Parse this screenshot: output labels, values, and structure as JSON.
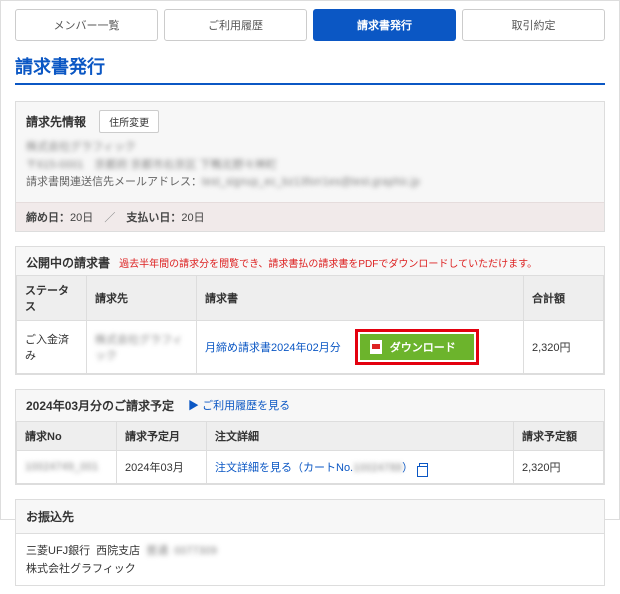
{
  "tabs": {
    "member_list": "メンバー一覧",
    "usage_history": "ご利用履歴",
    "invoice_issue": "請求書発行",
    "transaction_terms": "取引約定"
  },
  "page_title": "請求書発行",
  "billing_info": {
    "title": "請求先情報",
    "change_address_btn": "住所変更",
    "company_blur": "株式会社グラフィック",
    "postal_blur": "〒615-0001　京都府 京都市右京区 下鴨北野々神町",
    "email_label": "請求書関連送信先メールアドレス：",
    "email_blur": "test_signup_ec_bz13forr1es@test.graphic.jp",
    "cutoff_label": "締め日：",
    "cutoff_value": "20日",
    "payment_label": "支払い日：",
    "payment_value": "20日"
  },
  "published": {
    "title": "公開中の請求書",
    "note": "過去半年間の請求分を閲覧でき、請求書払の請求書をPDFでダウンロードしていただけます。",
    "cols": {
      "status": "ステータス",
      "billed_to": "請求先",
      "invoice": "請求書",
      "total": "合計額"
    },
    "row": {
      "status": "ご入金済み",
      "billed_to_blur": "株式会社グラフィック",
      "invoice_link": "月締め請求書2024年02月分",
      "download_label": "ダウンロード",
      "total": "2,320円"
    }
  },
  "schedule": {
    "title": "2024年03月分のご請求予定",
    "view_history_link": "ご利用履歴を見る",
    "cols": {
      "invoice_no": "請求No",
      "scheduled_month": "請求予定月",
      "order_detail": "注文詳細",
      "scheduled_amount": "請求予定額"
    },
    "row": {
      "invoice_no_blur": "10024749_001",
      "month": "2024年03月",
      "detail_prefix": "注文詳細を見る（カートNo.",
      "detail_cart_blur": "10024788",
      "detail_suffix": "）",
      "amount": "2,320円"
    }
  },
  "bank": {
    "title": "お振込先",
    "bank_name": "三菱UFJ銀行",
    "branch": "西院支店",
    "account_type_blur": "普通",
    "account_no_blur": "0077309",
    "holder": "株式会社グラフィック"
  }
}
